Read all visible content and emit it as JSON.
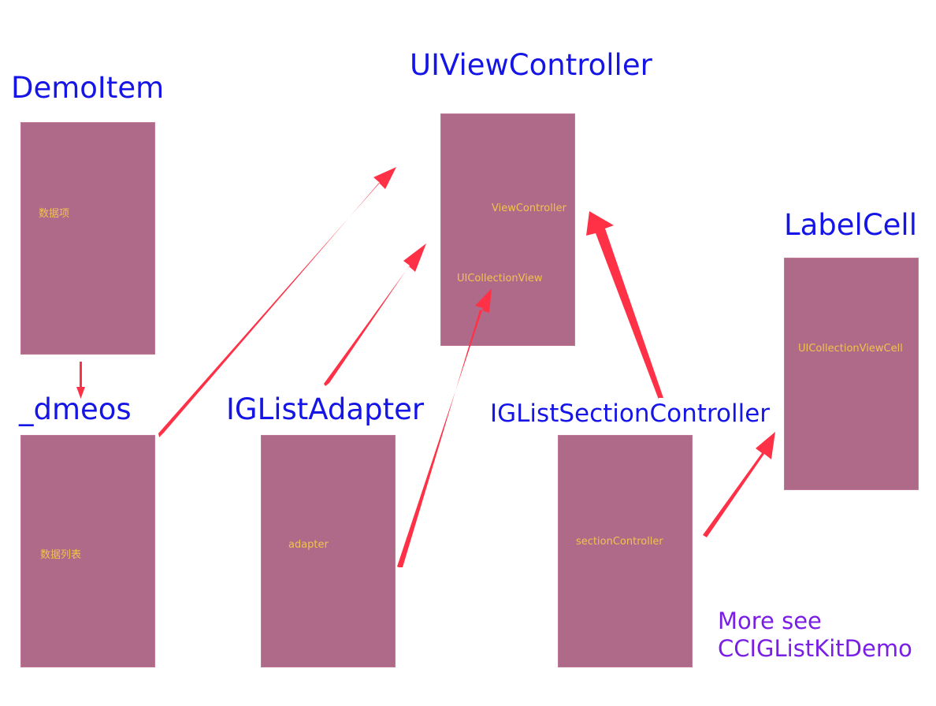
{
  "titles": {
    "demo_item": "DemoItem",
    "view_controller": "UIViewController",
    "label_cell": "LabelCell",
    "dmeos": "_dmeos",
    "adapter": "IGListAdapter",
    "section_controller": "IGListSectionController"
  },
  "boxes": {
    "demo_item": "数据项",
    "view_controller_top": "ViewController",
    "view_controller_bottom": "UICollectionView",
    "label_cell": "UICollectionViewCell",
    "dmeos": "数据列表",
    "adapter": "adapter",
    "section_controller": "sectionController"
  },
  "note": {
    "line1": "More see",
    "line2": "CCIGListKitDemo"
  },
  "colors": {
    "title": "#1515e6",
    "box": "#b06a89",
    "box_label": "#f0c24f",
    "arrow": "#ff3146",
    "note": "#7a1ee6"
  }
}
